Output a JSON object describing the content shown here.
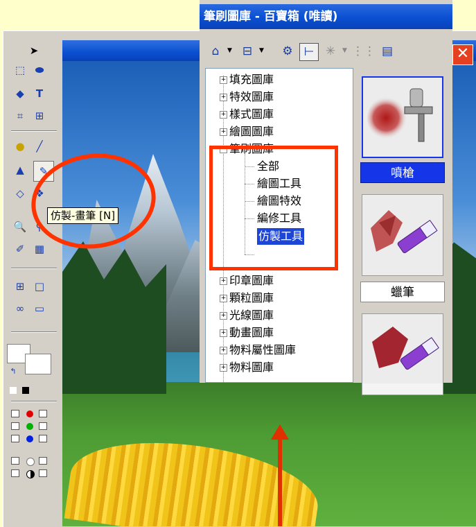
{
  "library": {
    "title": "筆刷圖庫 - 百寶箱 (唯讀)",
    "tree": [
      {
        "label": "填充圖庫",
        "expander": "+"
      },
      {
        "label": "特效圖庫",
        "expander": "+"
      },
      {
        "label": "樣式圖庫",
        "expander": "+"
      },
      {
        "label": "繪圖圖庫",
        "expander": "+"
      },
      {
        "label": "筆刷圖庫",
        "expander": "−",
        "children": [
          "全部",
          "繪圖工具",
          "繪圖特效",
          "編修工具",
          "仿製工具"
        ],
        "selected_child": "仿製工具"
      },
      {
        "label": "印章圖庫",
        "expander": "+"
      },
      {
        "label": "顆粒圖庫",
        "expander": "+"
      },
      {
        "label": "光線圖庫",
        "expander": "+"
      },
      {
        "label": "動畫圖庫",
        "expander": "+"
      },
      {
        "label": "物料屬性圖庫",
        "expander": "+"
      },
      {
        "label": "物料圖庫",
        "expander": "+"
      }
    ],
    "previews": [
      {
        "label": "噴槍",
        "selected": true
      },
      {
        "label": "蠟筆",
        "selected": false
      }
    ],
    "close_glyph": "✕"
  },
  "tooltip": "仿製-畫筆 [N]",
  "colors": {
    "highlight": "#ff3300",
    "titlebar": "#0b4fd2",
    "selection": "#1d46d6",
    "background": "#ffffcc"
  },
  "icons": {
    "pointer": "pointer-icon",
    "text": "text-icon",
    "clone_brush": "clone-brush-icon",
    "zoom": "zoom-icon"
  }
}
